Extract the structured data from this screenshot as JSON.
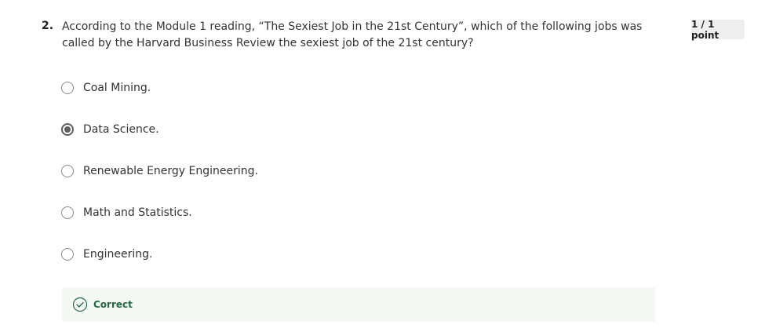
{
  "question": {
    "number": "2.",
    "text": "According to the Module 1 reading, “The Sexiest Job in the 21st Century”, which of the following jobs was called by the Harvard Business Review the sexiest job of the 21st century?",
    "score": "1 / 1 point"
  },
  "options": [
    {
      "label": "Coal Mining.",
      "selected": false
    },
    {
      "label": "Data Science.",
      "selected": true
    },
    {
      "label": "Renewable Energy Engineering.",
      "selected": false
    },
    {
      "label": "Math and Statistics.",
      "selected": false
    },
    {
      "label": "Engineering.",
      "selected": false
    }
  ],
  "feedback": {
    "status": "Correct",
    "icon": "check-circle-icon",
    "color": "#1f6b3f"
  }
}
